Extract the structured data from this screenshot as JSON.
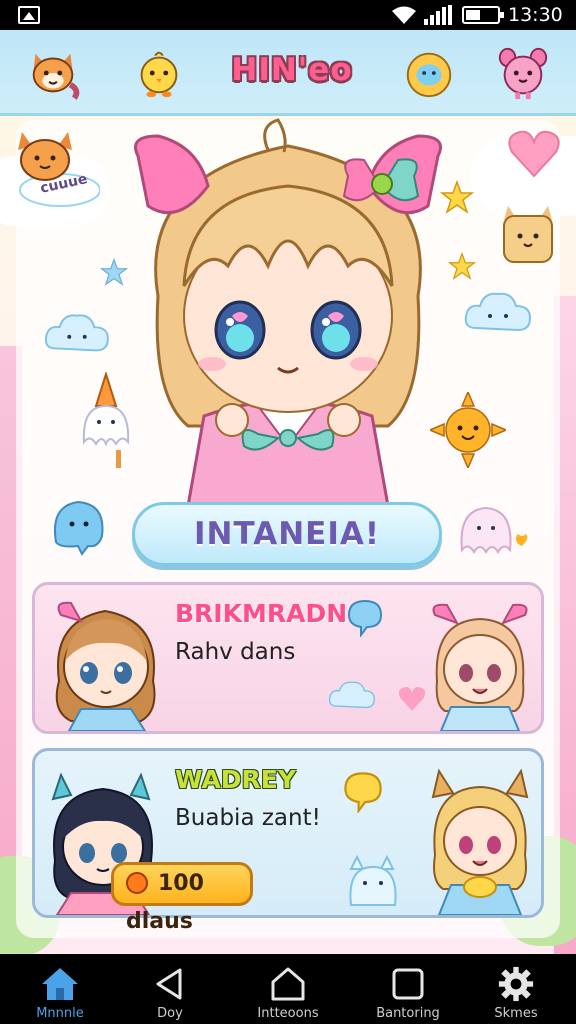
{
  "status_bar": {
    "time": "13:30"
  },
  "header": {
    "title": "HIN'eo"
  },
  "hero": {
    "cloud_label": "cuuue"
  },
  "action_button": {
    "label": "INTANEIA!"
  },
  "cards": [
    {
      "name": "BRIKMRADN",
      "message": "Rahv dans"
    },
    {
      "name": "WADREY",
      "message": "Buabia zant!",
      "badge": "100 dlaus"
    }
  ],
  "bottom_nav": [
    {
      "label": "Mnnnle",
      "icon": "home-icon",
      "active": true
    },
    {
      "label": "Doy",
      "icon": "back-icon",
      "active": false
    },
    {
      "label": "Intteoons",
      "icon": "house-outline-icon",
      "active": false
    },
    {
      "label": "Bantoring",
      "icon": "square-icon",
      "active": false
    },
    {
      "label": "Skmes",
      "icon": "gear-icon",
      "active": false
    }
  ],
  "colors": {
    "accent_pink": "#ff5f8f",
    "nav_active": "#4aa3e8",
    "header_bg": "#bfe6f7"
  }
}
